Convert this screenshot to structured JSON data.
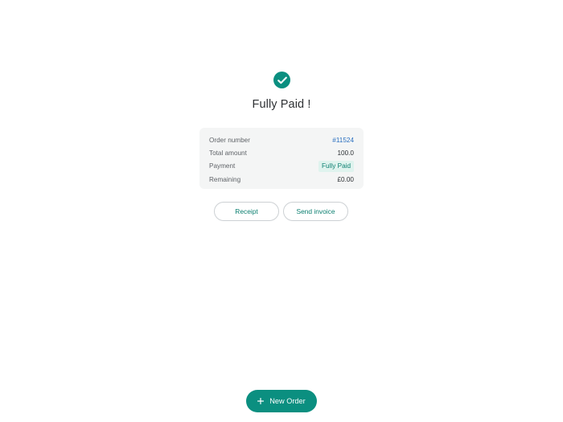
{
  "colors": {
    "accent": "#0b8f80",
    "link": "#2a6fc0",
    "badge_bg": "#dff3ee",
    "badge_text": "#0b7f70"
  },
  "status": {
    "icon": "check-circle-icon",
    "title": "Fully Paid !"
  },
  "summary": {
    "order_number_label": "Order number",
    "order_number_value": "#11524",
    "total_amount_label": "Total amount",
    "total_amount_value": "100.0",
    "payment_label": "Payment",
    "payment_value": "Fully Paid",
    "remaining_label": "Remaining",
    "remaining_value": "£0.00"
  },
  "actions": {
    "receipt_label": "Receipt",
    "send_invoice_label": "Send invoice"
  },
  "footer": {
    "new_order_icon": "plus-icon",
    "new_order_label": "New Order"
  }
}
